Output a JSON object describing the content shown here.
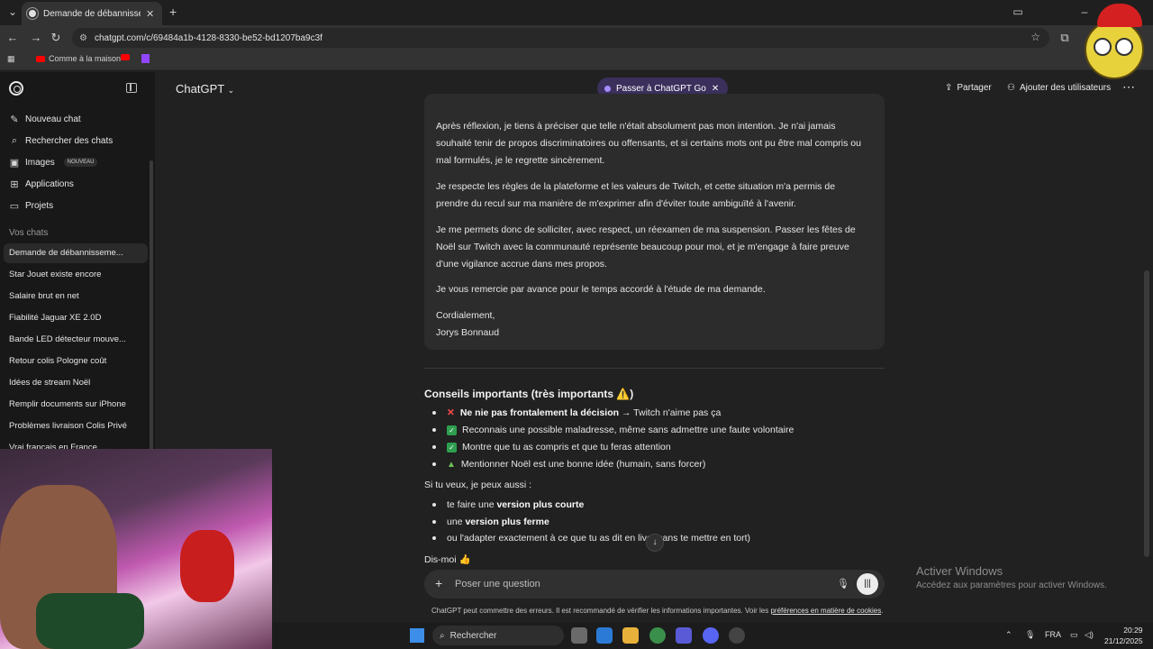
{
  "browser": {
    "tab_title": "Demande de débannissement Tw",
    "url": "chatgpt.com/c/69484a1b-4128-8330-be52-bd1207ba9c3f",
    "bookmarks": [
      {
        "label": "Comme à la maison"
      }
    ]
  },
  "sidebar": {
    "items": [
      {
        "label": "Nouveau chat",
        "icon": "edit-icon"
      },
      {
        "label": "Rechercher des chats",
        "icon": "search-icon"
      },
      {
        "label": "Images",
        "icon": "image-icon",
        "badge": "NOUVEAU"
      },
      {
        "label": "Applications",
        "icon": "grid-icon"
      },
      {
        "label": "Projets",
        "icon": "folder-icon"
      }
    ],
    "section_label": "Vos chats",
    "chats": [
      "Demande de débannisseme...",
      "Star Jouet existe encore",
      "Salaire brut en net",
      "Fiabilité Jaguar XE 2.0D",
      "Bande LED détecteur mouve...",
      "Retour colis Pologne coût",
      "Idées de stream Noël",
      "Remplir documents sur iPhone",
      "Problèmes livraison Colis Privé",
      "Vrai français en France"
    ]
  },
  "header": {
    "model": "ChatGPT",
    "promo": "Passer à ChatGPT Go",
    "share": "Partager",
    "add_users": "Ajouter des utilisateurs"
  },
  "message": {
    "paragraphs": [
      "Après réflexion, je tiens à préciser que telle n'était absolument pas mon intention. Je n'ai jamais souhaité tenir de propos discriminatoires ou offensants, et si certains mots ont pu être mal compris ou mal formulés, je le regrette sincèrement.",
      "Je respecte les règles de la plateforme et les valeurs de Twitch, et cette situation m'a permis de prendre du recul sur ma manière de m'exprimer afin d'éviter toute ambiguïté à l'avenir.",
      "Je me permets donc de solliciter, avec respect, un réexamen de ma suspension. Passer les fêtes de Noël sur Twitch avec la communauté représente beaucoup pour moi, et je m'engage à faire preuve d'une vigilance accrue dans mes propos.",
      "Je vous remercie par avance pour le temps accordé à l'étude de ma demande."
    ],
    "closing": "Cordialement,",
    "signature": "Jorys Bonnaud"
  },
  "advice": {
    "title": "Conseils importants (très importants ⚠️)",
    "items": [
      {
        "bold": "Ne nie pas frontalement la décision",
        "rest": " → Twitch n'aime pas ça",
        "icon": "cross-icon"
      },
      {
        "bold": "",
        "rest": "Reconnais une possible maladresse, même sans admettre une faute volontaire",
        "icon": "check-icon"
      },
      {
        "bold": "",
        "rest": "Montre que tu as compris et que tu feras attention",
        "icon": "check-icon"
      },
      {
        "bold": "",
        "rest": "Mentionner Noël est une bonne idée (humain, sans forcer)",
        "icon": "tree-icon"
      }
    ],
    "intro": "Si tu veux, je peux aussi :",
    "options": [
      {
        "pre": "te faire une ",
        "bold": "version plus courte"
      },
      {
        "pre": "une ",
        "bold": "version plus ferme"
      },
      {
        "pre": "ou l'adapter exactement à ce que tu as dit en live (sans te mettre en tort)",
        "bold": ""
      }
    ],
    "outro": "Dis-moi 👍"
  },
  "composer": {
    "placeholder": "Poser une question",
    "disclaimer": "ChatGPT peut commettre des erreurs. Il est recommandé de vérifier les informations importantes. Voir les ",
    "disclaimer_link": "préférences en matière de cookies",
    "disclaimer_end": "."
  },
  "windows": {
    "activate_title": "Activer Windows",
    "activate_sub": "Accédez aux paramètres pour activer Windows.",
    "search": "Rechercher",
    "lang": "FRA",
    "time": "20:29",
    "date": "21/12/2025"
  }
}
